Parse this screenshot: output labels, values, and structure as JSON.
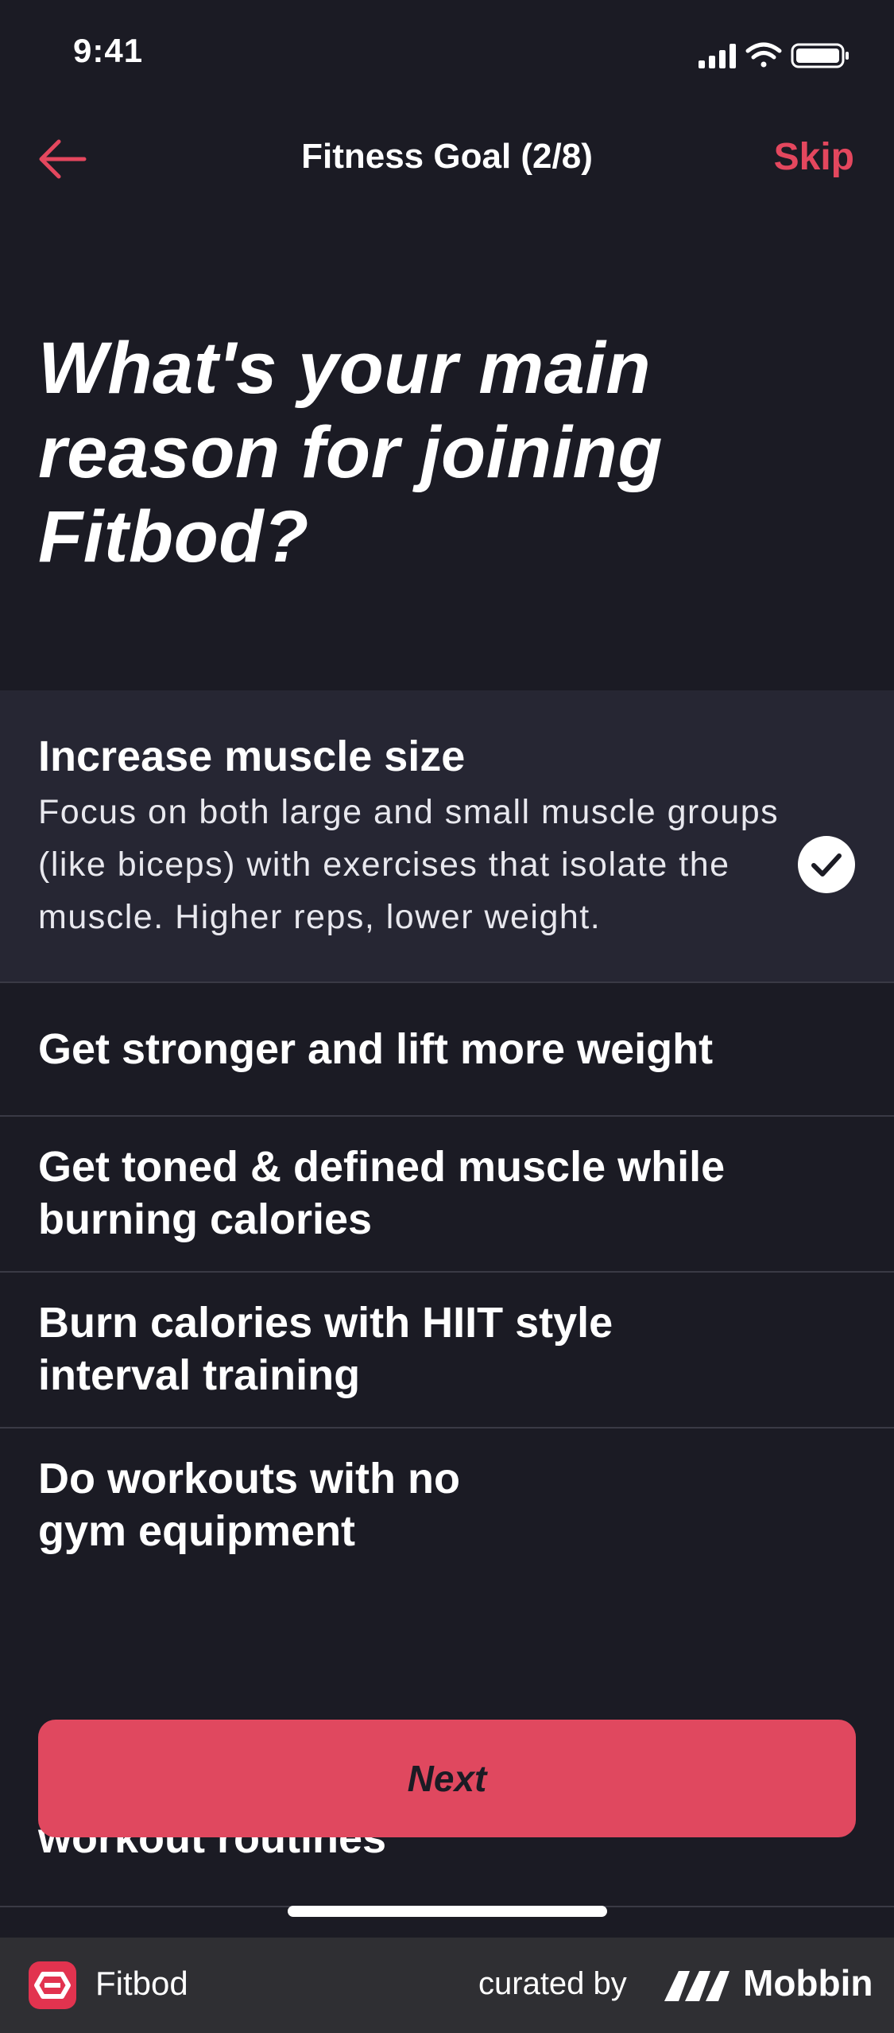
{
  "status_bar": {
    "time": "9:41"
  },
  "nav": {
    "title": "Fitness Goal (2/8)",
    "skip_label": "Skip"
  },
  "question": "What's your main reason for joining Fitbod?",
  "options": [
    {
      "title": "Increase muscle size",
      "description": "Focus on both large and small muscle groups (like biceps) with exercises that isolate the muscle. Higher reps, lower weight.",
      "selected": true
    },
    {
      "title": "Get stronger and lift more weight",
      "selected": false
    },
    {
      "title": "Get toned & defined muscle while burning calories",
      "selected": false
    },
    {
      "title": "Burn calories with HIIT style interval training",
      "selected": false
    },
    {
      "title": "Do workouts with no gym equipment",
      "selected": false
    },
    {
      "title": "workout routines",
      "selected": false
    }
  ],
  "next_label": "Next",
  "footer": {
    "app_name": "Fitbod",
    "curated_by": "curated by",
    "brand": "Mobbin"
  },
  "colors": {
    "accent": "#e0485f",
    "background": "#1b1b24",
    "selected_bg": "#262633"
  },
  "icons": {
    "back": "arrow-left-icon",
    "check": "checkmark-circle-icon",
    "signal": "cellular-signal-icon",
    "wifi": "wifi-icon",
    "battery": "battery-icon"
  }
}
